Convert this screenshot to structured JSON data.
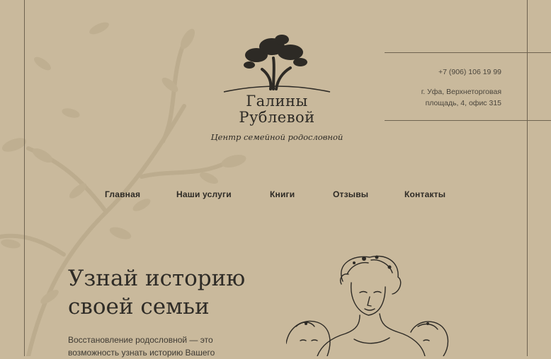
{
  "logo": {
    "line1": "Галины",
    "line2": "Рублевой",
    "tagline": "Центр семейной родословной",
    "icon": "olive-tree-icon"
  },
  "contacts": {
    "phone": "+7 (906) 106 19 99",
    "address_line1": "г. Уфа, Верхнеторговая",
    "address_line2": "площадь, 4, офис 315"
  },
  "nav": {
    "items": [
      {
        "label": "Главная"
      },
      {
        "label": "Наши услуги"
      },
      {
        "label": "Книги"
      },
      {
        "label": "Отзывы"
      },
      {
        "label": "Контакты"
      }
    ]
  },
  "hero": {
    "title_line1": "Узнай историю",
    "title_line2": "своей семьи",
    "text_line1": "Восстановление родословной — это",
    "text_line2": "возможность узнать историю Вашего"
  },
  "colors": {
    "background": "#c9b99c",
    "text": "#2d2a25",
    "lines": "#6e6350"
  }
}
